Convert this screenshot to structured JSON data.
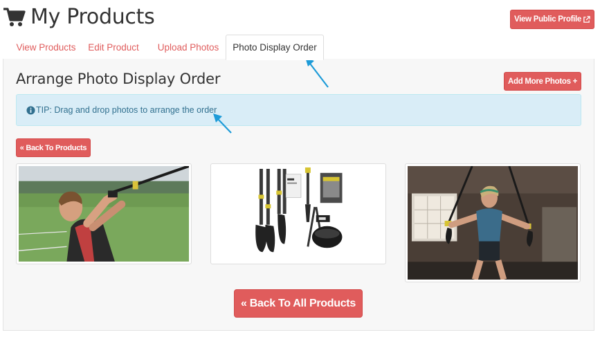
{
  "header": {
    "title": "My Products",
    "public_profile_label": "View Public Profile"
  },
  "tabs": [
    {
      "label": "View Products",
      "active": false
    },
    {
      "label": "Edit Product",
      "active": false
    },
    {
      "label": "Upload Photos",
      "active": false
    },
    {
      "label": "Photo Display Order",
      "active": true
    }
  ],
  "main": {
    "section_title": "Arrange Photo Display Order",
    "add_more_label": "Add More Photos +",
    "tip_text": "TIP: Drag and drop photos to arrange the order",
    "back_products_label": "« Back To Products",
    "back_all_label": "« Back To All Products"
  },
  "icons": {
    "cart": "shopping-cart-icon",
    "external": "external-link-icon",
    "info": "info-circle-icon"
  },
  "colors": {
    "accent": "#e05c5c",
    "tip_bg": "#d9edf7",
    "tip_text": "#31708f",
    "annotation_arrow": "#1d9bd8"
  }
}
